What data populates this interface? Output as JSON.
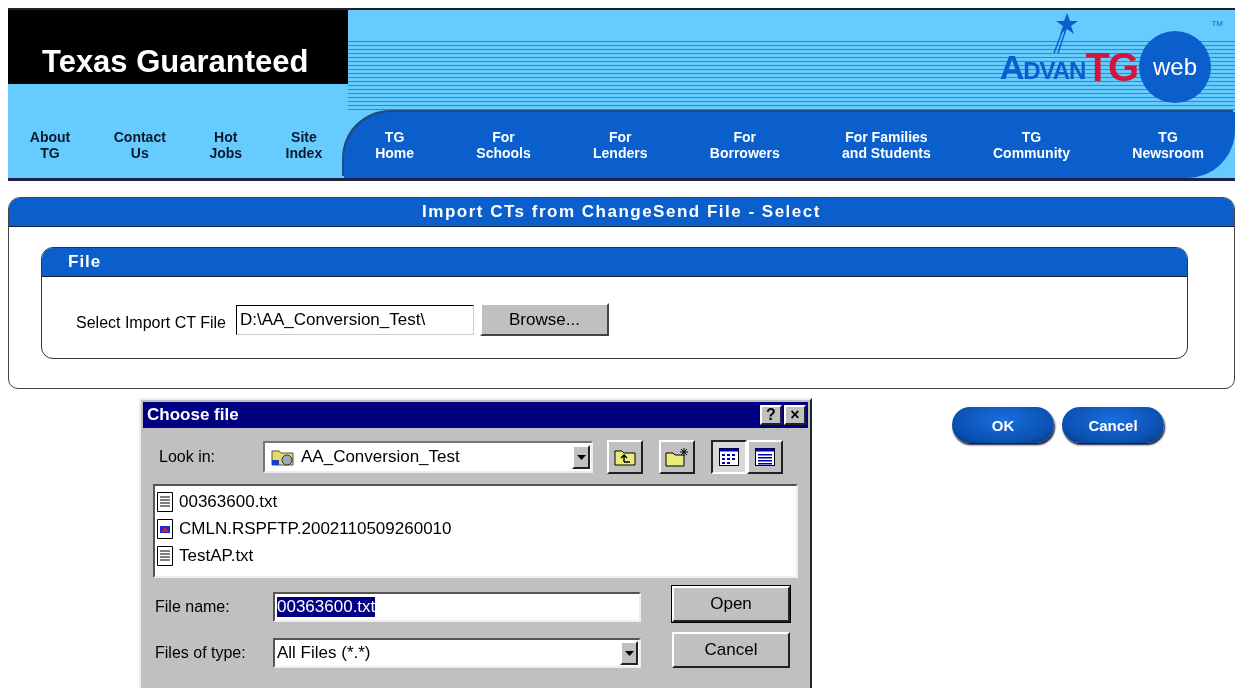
{
  "header": {
    "brand": "Texas Guaranteed",
    "logo": {
      "advan": "Advan",
      "tg": "TG",
      "web": "web",
      "tm": "TM"
    }
  },
  "nav": [
    {
      "label": "About\nTG",
      "kind": "utility"
    },
    {
      "label": "Contact\nUs",
      "kind": "utility"
    },
    {
      "label": "Hot\nJobs",
      "kind": "utility"
    },
    {
      "label": "Site\nIndex",
      "kind": "utility"
    },
    {
      "label": "TG\nHome",
      "kind": "main"
    },
    {
      "label": "For\nSchools",
      "kind": "main"
    },
    {
      "label": "For\nLenders",
      "kind": "main"
    },
    {
      "label": "For\nBorrowers",
      "kind": "main"
    },
    {
      "label": "For Families\nand Students",
      "kind": "main"
    },
    {
      "label": "TG\nCommunity",
      "kind": "main"
    },
    {
      "label": "TG\nNewsroom",
      "kind": "main"
    }
  ],
  "page": {
    "title": "Import CTs from ChangeSend File - Select",
    "panel_title": "File",
    "field_label": "Select Import CT File",
    "field_value": "D:\\AA_Conversion_Test\\",
    "browse": "Browse...",
    "buttons": [
      "OK",
      "Cancel"
    ]
  },
  "dialog": {
    "title": "Choose file",
    "help": "?",
    "close": "×",
    "look_in_label": "Look in:",
    "look_in_value": "AA_Conversion_Test",
    "views": [
      {
        "kind": "list",
        "selected": true
      },
      {
        "kind": "details",
        "selected": false
      }
    ],
    "files": [
      {
        "name": "00363600.txt",
        "kind": "text"
      },
      {
        "name": "CMLN.RSPFTP.2002110509260010",
        "kind": "app"
      },
      {
        "name": "TestAP.txt",
        "kind": "text"
      }
    ],
    "file_name_label": "File name:",
    "file_name_value": "00363600.txt",
    "file_name_selected": true,
    "type_label": "Files of type:",
    "type_value": "All Files (*.*)",
    "open": "Open",
    "cancel": "Cancel"
  }
}
